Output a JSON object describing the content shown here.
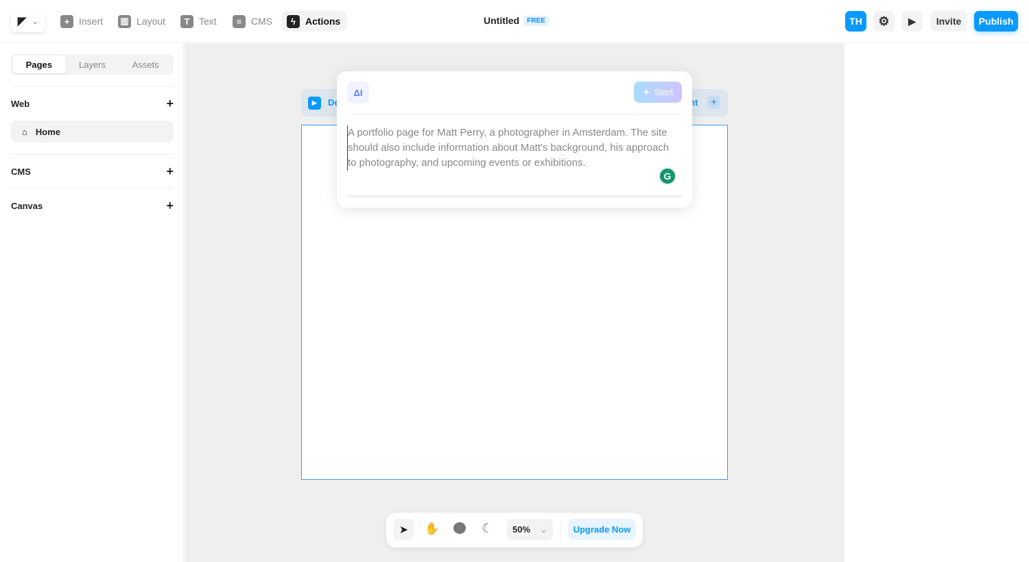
{
  "toolbar": {
    "items": [
      {
        "label": "Insert",
        "icon": "plus-icon"
      },
      {
        "label": "Layout",
        "icon": "layout-icon"
      },
      {
        "label": "Text",
        "icon": "text-icon"
      },
      {
        "label": "CMS",
        "icon": "database-icon"
      },
      {
        "label": "Actions",
        "icon": "bolt-icon"
      }
    ],
    "title": "Untitled",
    "plan_badge": "FREE",
    "avatar": "TH",
    "invite": "Invite",
    "publish": "Publish"
  },
  "sidebar": {
    "tabs": [
      "Pages",
      "Layers",
      "Assets"
    ],
    "sections": [
      "Web",
      "CMS",
      "Canvas"
    ],
    "home": "Home"
  },
  "canvas": {
    "frame_left_label": "De",
    "frame_right_label": "nt",
    "prompt": {
      "ai_label": "AI",
      "start": "Start",
      "text": "A portfolio page for Matt Perry, a photographer in Amsterdam. The site should also include information about Matt's background, his approach to photography, and upcoming events or exhibitions."
    }
  },
  "bottombar": {
    "zoom": "50%",
    "upgrade": "Upgrade Now"
  },
  "colors": {
    "accent": "#0a99ff",
    "frame_border": "#3a9bf0"
  }
}
